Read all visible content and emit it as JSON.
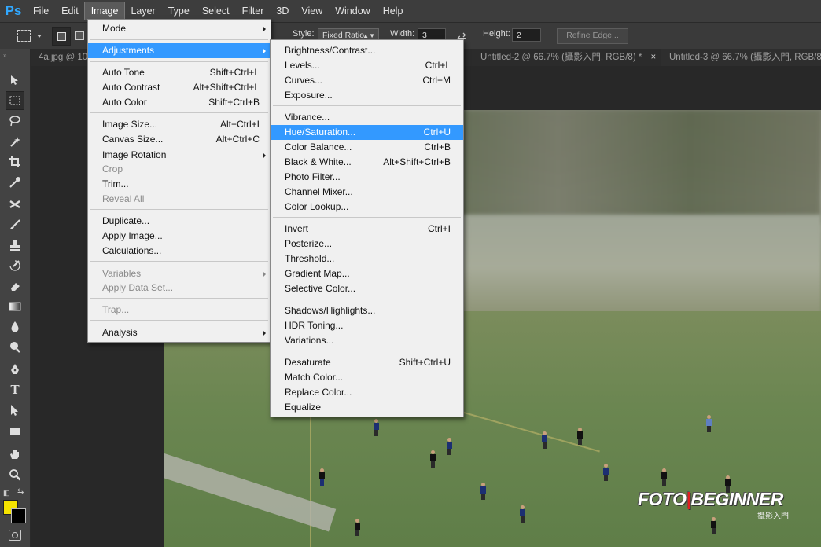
{
  "app": {
    "logo": "Ps"
  },
  "menubar": {
    "items": [
      "File",
      "Edit",
      "Image",
      "Layer",
      "Type",
      "Select",
      "Filter",
      "3D",
      "View",
      "Window",
      "Help"
    ]
  },
  "options": {
    "style_label": "Style:",
    "style_value": "Fixed Ratio",
    "width_label": "Width:",
    "width_value": "3",
    "height_label": "Height:",
    "height_value": "2",
    "refine_edge": "Refine Edge..."
  },
  "tabs": [
    {
      "label": "4a.jpg @ 10"
    },
    {
      "label": "Untitled-2 @ 66.7% (攝影入門, RGB/8) *"
    },
    {
      "label": "Untitled-3 @ 66.7% (攝影入門, RGB/8"
    }
  ],
  "image_menu": {
    "items": [
      {
        "label": "Mode",
        "shortcut": "",
        "submenu": true,
        "disabled": false
      },
      {
        "label": "Adjustments",
        "shortcut": "",
        "submenu": true,
        "disabled": false,
        "highlighted": true
      },
      {
        "label": "Auto Tone",
        "shortcut": "Shift+Ctrl+L"
      },
      {
        "label": "Auto Contrast",
        "shortcut": "Alt+Shift+Ctrl+L"
      },
      {
        "label": "Auto Color",
        "shortcut": "Shift+Ctrl+B"
      },
      {
        "label": "Image Size...",
        "shortcut": "Alt+Ctrl+I"
      },
      {
        "label": "Canvas Size...",
        "shortcut": "Alt+Ctrl+C"
      },
      {
        "label": "Image Rotation",
        "shortcut": "",
        "submenu": true
      },
      {
        "label": "Crop",
        "shortcut": "",
        "disabled": true
      },
      {
        "label": "Trim...",
        "shortcut": ""
      },
      {
        "label": "Reveal All",
        "shortcut": "",
        "disabled": true
      },
      {
        "label": "Duplicate...",
        "shortcut": ""
      },
      {
        "label": "Apply Image...",
        "shortcut": ""
      },
      {
        "label": "Calculations...",
        "shortcut": ""
      },
      {
        "label": "Variables",
        "shortcut": "",
        "submenu": true,
        "disabled": true
      },
      {
        "label": "Apply Data Set...",
        "shortcut": "",
        "disabled": true
      },
      {
        "label": "Trap...",
        "shortcut": "",
        "disabled": true
      },
      {
        "label": "Analysis",
        "shortcut": "",
        "submenu": true
      }
    ]
  },
  "adjustments_menu": {
    "items": [
      {
        "label": "Brightness/Contrast...",
        "shortcut": ""
      },
      {
        "label": "Levels...",
        "shortcut": "Ctrl+L"
      },
      {
        "label": "Curves...",
        "shortcut": "Ctrl+M"
      },
      {
        "label": "Exposure...",
        "shortcut": ""
      },
      {
        "label": "Vibrance...",
        "shortcut": ""
      },
      {
        "label": "Hue/Saturation...",
        "shortcut": "Ctrl+U",
        "highlighted": true
      },
      {
        "label": "Color Balance...",
        "shortcut": "Ctrl+B"
      },
      {
        "label": "Black & White...",
        "shortcut": "Alt+Shift+Ctrl+B"
      },
      {
        "label": "Photo Filter...",
        "shortcut": ""
      },
      {
        "label": "Channel Mixer...",
        "shortcut": ""
      },
      {
        "label": "Color Lookup...",
        "shortcut": ""
      },
      {
        "label": "Invert",
        "shortcut": "Ctrl+I"
      },
      {
        "label": "Posterize...",
        "shortcut": ""
      },
      {
        "label": "Threshold...",
        "shortcut": ""
      },
      {
        "label": "Gradient Map...",
        "shortcut": ""
      },
      {
        "label": "Selective Color...",
        "shortcut": ""
      },
      {
        "label": "Shadows/Highlights...",
        "shortcut": ""
      },
      {
        "label": "HDR Toning...",
        "shortcut": ""
      },
      {
        "label": "Variations...",
        "shortcut": ""
      },
      {
        "label": "Desaturate",
        "shortcut": "Shift+Ctrl+U"
      },
      {
        "label": "Match Color...",
        "shortcut": ""
      },
      {
        "label": "Replace Color...",
        "shortcut": ""
      },
      {
        "label": "Equalize",
        "shortcut": ""
      }
    ]
  },
  "watermark": {
    "main_left": "FOTO",
    "main_sep": "|",
    "main_right": "BEGINNER",
    "sub": "攝影入門"
  },
  "colors": {
    "foreground": "#f6e400",
    "background": "#000000",
    "menu_highlight": "#3399ff"
  }
}
